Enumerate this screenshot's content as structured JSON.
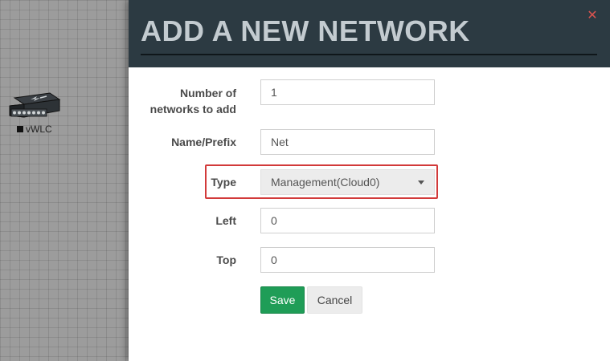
{
  "canvas": {
    "node": {
      "label": "vWLC",
      "icon": "switch-icon"
    }
  },
  "modal": {
    "title": "ADD A NEW NETWORK",
    "close_icon": "close-icon",
    "colors": {
      "header_bg": "#2c3a42",
      "title": "#c3cbd0",
      "close": "#d9534f",
      "highlight": "#d23a3a",
      "save": "#1f9d57"
    },
    "fields": {
      "count": {
        "label_line1": "Number of",
        "label_line2": "networks to add",
        "value": "1"
      },
      "name": {
        "label": "Name/Prefix",
        "value": "Net"
      },
      "type": {
        "label": "Type",
        "selected": "Management(Cloud0)"
      },
      "left": {
        "label": "Left",
        "value": "0"
      },
      "top": {
        "label": "Top",
        "value": "0"
      }
    },
    "buttons": {
      "save": "Save",
      "cancel": "Cancel"
    }
  }
}
